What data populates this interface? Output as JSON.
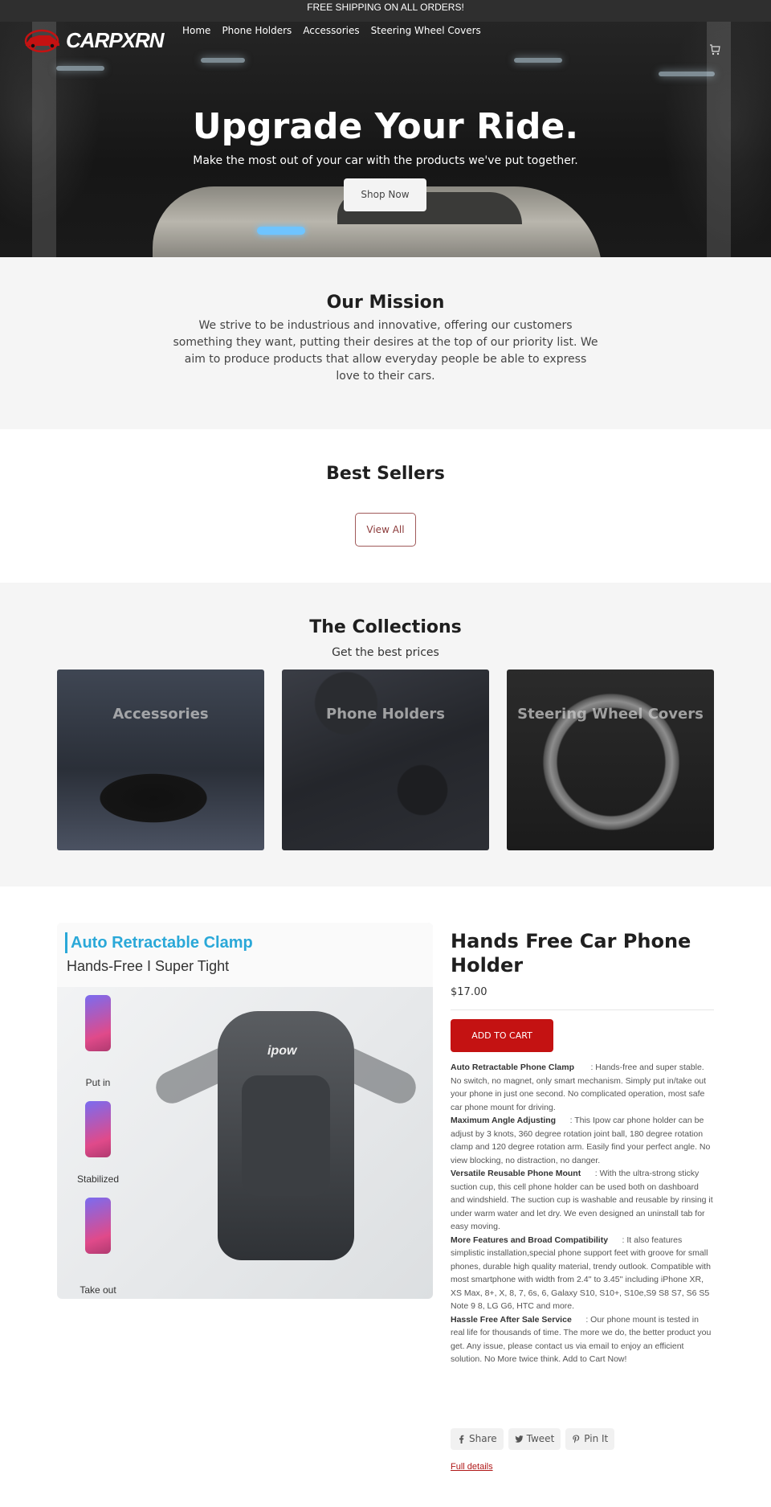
{
  "announcement": "FREE SHIPPING ON ALL ORDERS!",
  "brand": {
    "name": "CARPXRN",
    "accent": "#c41212"
  },
  "nav": {
    "items": [
      "Home",
      "Phone Holders",
      "Accessories",
      "Steering Wheel Covers"
    ],
    "cart_icon": "cart-icon"
  },
  "hero": {
    "title": "Upgrade Your Ride.",
    "subtitle": "Make the most out of your car with the products we've put together.",
    "cta": "Shop Now"
  },
  "mission": {
    "title": "Our Mission",
    "text": "We strive to be industrious and innovative, offering our customers something they want, putting their desires at the top of our priority list. We aim to produce products that allow everyday people be able to express love to their cars."
  },
  "best_sellers": {
    "title": "Best Sellers",
    "view_all": "View All"
  },
  "collections": {
    "title": "The Collections",
    "subtitle": "Get the best prices",
    "cards": [
      "Accessories",
      "Phone Holders",
      "Steering Wheel Covers"
    ]
  },
  "product": {
    "image_text": {
      "title": "Auto Retractable Clamp",
      "subtitle": "Hands-Free I Super Tight",
      "brand": "ipow",
      "steps": [
        "Put in",
        "Stabilized",
        "Take out"
      ]
    },
    "title": "Hands Free Car Phone Holder",
    "price": "$17.00",
    "add_to_cart": "ADD TO CART",
    "features": [
      {
        "heading": "Auto Retractable Phone Clamp",
        "text": ": Hands-free and super stable. No switch, no magnet, only smart mechanism. Simply put in/take out your phone in just one second. No complicated operation, most safe car phone mount for driving."
      },
      {
        "heading": "Maximum Angle Adjusting",
        "text": ": This Ipow car phone holder can be adjust by 3 knots, 360 degree rotation joint ball, 180 degree rotation clamp and 120 degree rotation arm. Easily find your perfect angle. No view blocking, no distraction, no danger."
      },
      {
        "heading": "Versatile Reusable Phone Mount",
        "text": ": With the ultra-strong sticky suction cup, this cell phone holder can be used both on dashboard and windshield. The suction cup is washable and reusable by rinsing it under warm water and let dry. We even designed an uninstall tab for easy moving."
      },
      {
        "heading": "More Features and Broad Compatibility",
        "text": ": It also features simplistic installation,special phone support feet with groove for small phones, durable high quality material, trendy outlook. Compatible with most smartphone with width from 2.4'' to 3.45'' including iPhone XR, XS Max, 8+, X, 8, 7, 6s, 6, Galaxy S10, S10+, S10e,S9 S8 S7, S6 S5 Note 9 8, LG G6, HTC and more."
      },
      {
        "heading": "Hassle Free After Sale Service",
        "text": ": Our phone mount is tested in real life for thousands of time. The more we do, the better product you get. Any issue, please contact us via email to enjoy an efficient solution. No More twice think. Add to Cart Now!"
      }
    ],
    "share": [
      "Share",
      "Tweet",
      "Pin It"
    ],
    "full_details": "Full details"
  }
}
